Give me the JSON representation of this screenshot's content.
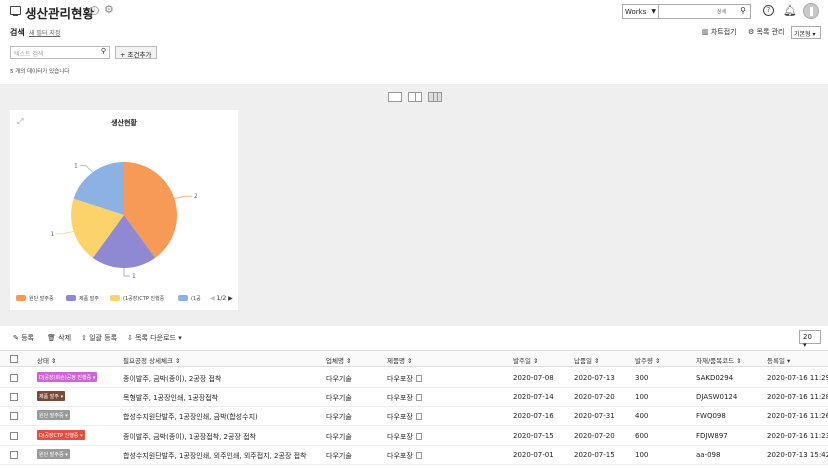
{
  "header": {
    "title": "생산관리현황",
    "works_select": "Works",
    "search_sub": "상세",
    "colors": {
      "accent": "#333333"
    }
  },
  "filter": {
    "search_label": "검색",
    "new_filter": "새 필터 지정",
    "text_search_placeholder": "텍스트 검색",
    "add_condition": "조건추가",
    "count_text": "5 개의 데이터가 있습니다",
    "chart_toggle": "차트접기",
    "list_manage": "목록 관리",
    "view_select": "기본형"
  },
  "chart_data": {
    "type": "pie",
    "title": "생산현황",
    "categories": [
      "원단 발주중",
      "제품 발주",
      "(1공장)CTP 진행중",
      "(1공"
    ],
    "values": [
      2,
      1,
      1,
      1
    ],
    "colors": [
      "#f79a55",
      "#8f88d2",
      "#fcd36a",
      "#8cb2e3"
    ],
    "legend_position": "bottom",
    "legend_page": "1/2"
  },
  "toolbar": {
    "register": "등록",
    "delete": "삭제",
    "bulk_register": "일괄 등록",
    "download": "목록 다운로드",
    "page_size": "20"
  },
  "table": {
    "headers": [
      "상태",
      "필요공정 상세체크",
      "업체명",
      "제품명",
      "발주일",
      "납품일",
      "발주량",
      "자재/품목코드",
      "등록일"
    ],
    "rows": [
      {
        "status": "DJ공장(회손)공정 진행중",
        "status_color": "#d064d6",
        "process": "종이발주, 금박(종이), 2공장 접착",
        "company": "다우기술",
        "product": "다우포장",
        "order_date": "2020-07-08",
        "delivery": "2020-07-13",
        "qty": "300",
        "code": "SAKD0294",
        "reg": "2020-07-16 11:29"
      },
      {
        "status": "제품 발주",
        "status_color": "#7a4a35",
        "process": "목형발주, 1공장인쇄, 1공장접착",
        "company": "다우기술",
        "product": "다우포장",
        "order_date": "2020-07-14",
        "delivery": "2020-07-20",
        "qty": "100",
        "code": "DJASW0124",
        "reg": "2020-07-16 11:28"
      },
      {
        "status": "원단 발주중",
        "status_color": "#9a9a9a",
        "process": "합성수지원단발주, 1공장인쇄, 금박(합성수지)",
        "company": "다우기술",
        "product": "다우포장",
        "order_date": "2020-07-16",
        "delivery": "2020-07-31",
        "qty": "400",
        "code": "FWQ098",
        "reg": "2020-07-16 11:26"
      },
      {
        "status": "DJ공장CTP 진행중",
        "status_color": "#e84c3d",
        "process": "종이발주, 금박(종이), 1공장접착, 2공장 접착",
        "company": "다우기술",
        "product": "다우포장",
        "order_date": "2020-07-15",
        "delivery": "2020-07-20",
        "qty": "600",
        "code": "FDJW897",
        "reg": "2020-07-16 11:23"
      },
      {
        "status": "원단 발주중",
        "status_color": "#9a9a9a",
        "process": "합성수지원단발주, 1공장인쇄, 외주인쇄, 외주접지, 2공장 접착",
        "company": "다우기술",
        "product": "다우포장",
        "order_date": "2020-07-01",
        "delivery": "2020-07-15",
        "qty": "100",
        "code": "aa-098",
        "reg": "2020-07-13 15:42"
      }
    ]
  }
}
